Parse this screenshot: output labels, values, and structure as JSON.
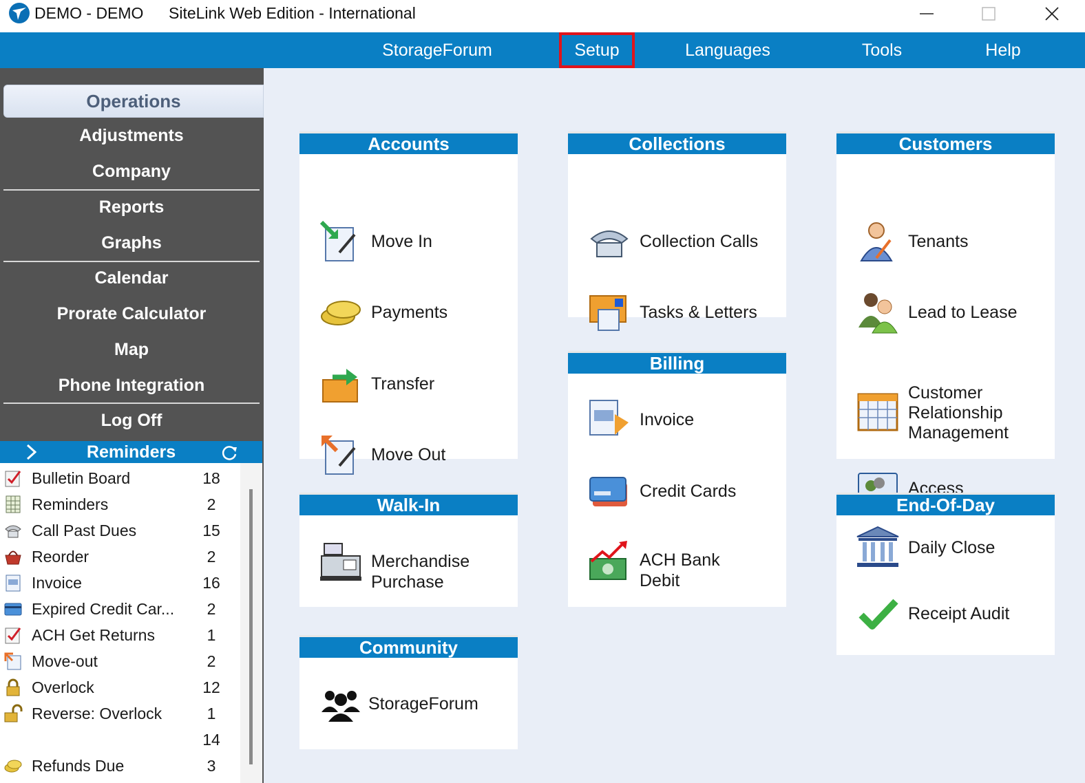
{
  "titlebar": {
    "left_title": "DEMO - DEMO",
    "app_title": "SiteLink Web Edition - International"
  },
  "menu": {
    "items": [
      {
        "label": "StorageForum"
      },
      {
        "label": "Setup",
        "highlighted": true
      },
      {
        "label": "Languages"
      },
      {
        "label": "Tools"
      },
      {
        "label": "Help"
      }
    ]
  },
  "sidebar": {
    "active": "Operations",
    "items": [
      "Adjustments",
      "Company",
      "Reports",
      "Graphs",
      "Calendar",
      "Prorate Calculator",
      "Map",
      "Phone Integration",
      "Log Off"
    ]
  },
  "reminders": {
    "title": "Reminders",
    "rows": [
      {
        "icon": "bulletin-board-icon",
        "label": "Bulletin Board",
        "count": "18"
      },
      {
        "icon": "calendar-grid-icon",
        "label": "Reminders",
        "count": "2"
      },
      {
        "icon": "phone-icon",
        "label": "Call Past Dues",
        "count": "15"
      },
      {
        "icon": "basket-icon",
        "label": "Reorder",
        "count": "2"
      },
      {
        "icon": "invoice-icon",
        "label": "Invoice",
        "count": "16"
      },
      {
        "icon": "credit-card-icon",
        "label": "Expired Credit Car...",
        "count": "2"
      },
      {
        "icon": "checklist-icon",
        "label": "ACH Get Returns",
        "count": "1"
      },
      {
        "icon": "move-out-icon",
        "label": "Move-out",
        "count": "2"
      },
      {
        "icon": "lock-icon",
        "label": "Overlock",
        "count": "12"
      },
      {
        "icon": "unlock-icon",
        "label": "Reverse: Overlock",
        "count": "1"
      },
      {
        "icon": "",
        "label": "",
        "count": "14"
      },
      {
        "icon": "coins-icon",
        "label": "Refunds Due",
        "count": "3"
      }
    ]
  },
  "panels": {
    "accounts": {
      "title": "Accounts",
      "items": [
        "Move In",
        "Payments",
        "Transfer",
        "Move Out"
      ]
    },
    "walkin": {
      "title": "Walk-In",
      "items": [
        "Merchandise\nPurchase"
      ]
    },
    "community": {
      "title": "Community",
      "items": [
        "StorageForum"
      ]
    },
    "collections": {
      "title": "Collections",
      "items": [
        "Collection Calls",
        "Tasks & Letters"
      ]
    },
    "billing": {
      "title": "Billing",
      "items": [
        "Invoice",
        "Credit Cards",
        "ACH Bank\nDebit"
      ]
    },
    "customers": {
      "title": "Customers",
      "items": [
        "Tenants",
        "Lead to Lease",
        "Customer\nRelationship\nManagement",
        "Access"
      ]
    },
    "eod": {
      "title": "End-Of-Day",
      "items": [
        "Daily Close",
        "Receipt Audit"
      ]
    }
  },
  "colors": {
    "accent_blue": "#0a7fc4",
    "sidebar_gray": "#535353",
    "highlight_red": "#e0141b",
    "main_bg": "#e9eef7"
  }
}
